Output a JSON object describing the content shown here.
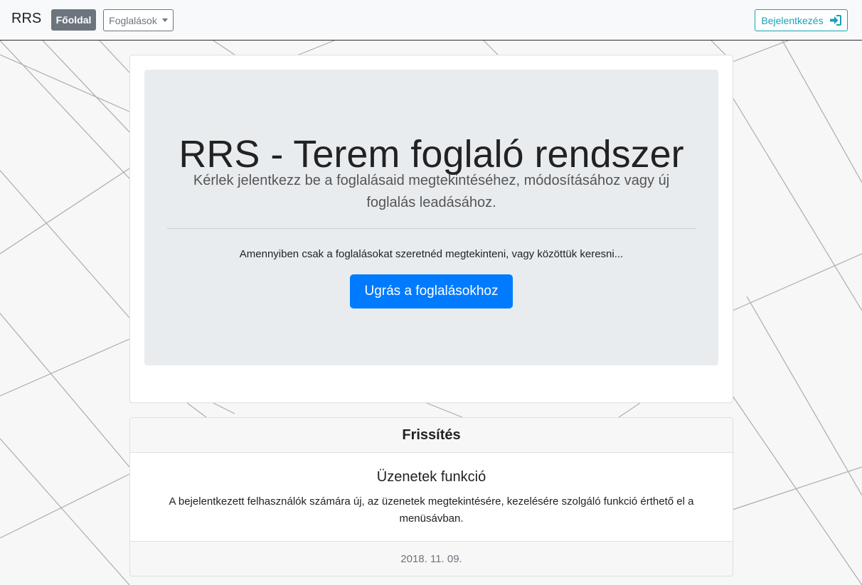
{
  "navbar": {
    "brand": "RRS",
    "home_label": "Főoldal",
    "reservations_label": "Foglalások",
    "login_label": "Bejelentkezés",
    "login_icon": "sign-in-icon"
  },
  "hero": {
    "title": "RRS - Terem foglaló rendszer",
    "lead": "Kérlek jelentkezz be a foglalásaid megtekintéséhez, módosításához vagy új foglalás leadásához.",
    "info": "Amennyiben csak a foglalásokat szeretnéd megtekinteni, vagy közöttük keresni...",
    "button_label": "Ugrás a foglalásokhoz"
  },
  "update": {
    "header": "Frissítés",
    "title": "Üzenetek funkció",
    "text": "A bejelentkezett felhasználók számára új, az üzenetek megtekintésére, kezelésére szolgáló funkció érthető el a menüsávban.",
    "date": "2018. 11. 09."
  },
  "colors": {
    "primary": "#007bff",
    "secondary": "#6c757d",
    "info": "#17a2b8"
  }
}
